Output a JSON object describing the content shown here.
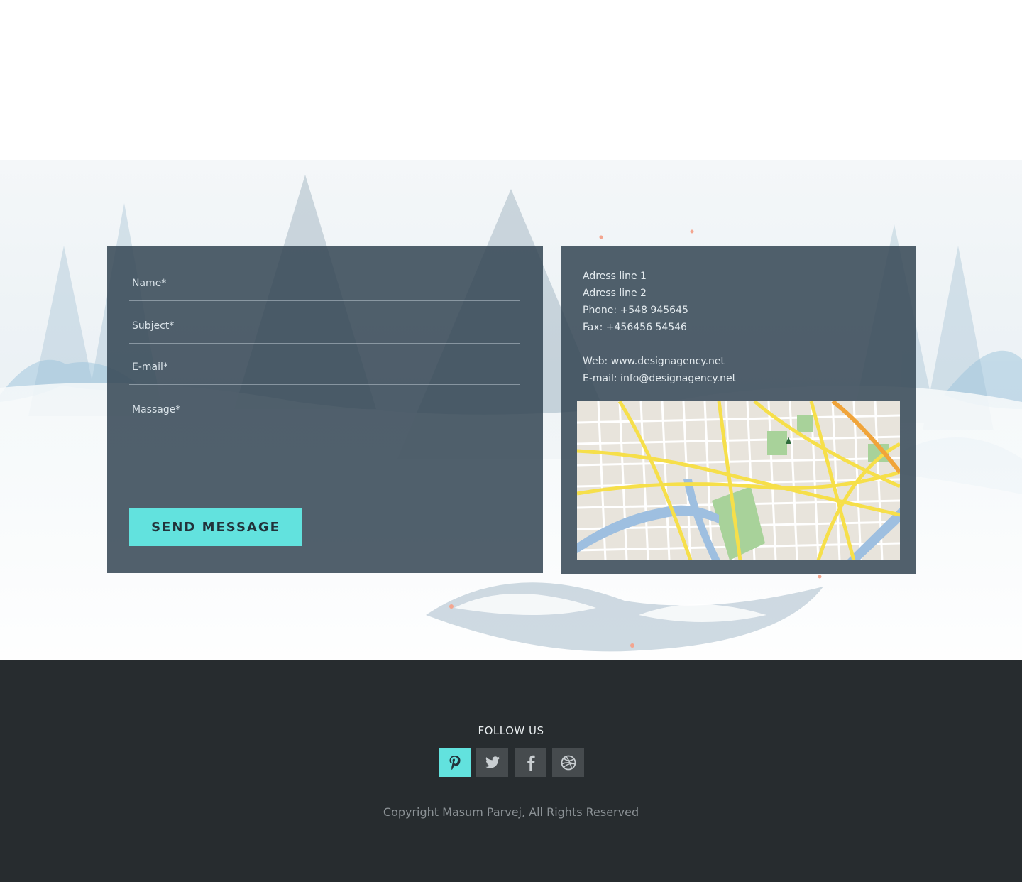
{
  "contact_form": {
    "name_placeholder": "Name*",
    "subject_placeholder": "Subject*",
    "email_placeholder": "E-mail*",
    "message_placeholder": "Massage*",
    "send_label": "SEND MESSAGE"
  },
  "contact_info": {
    "address_line_1": "Adress line 1",
    "address_line_2": "Adress line 2",
    "phone": "Phone: +548 945645",
    "fax": "Fax: +456456 54546",
    "web": "Web: www.designagency.net",
    "email": "E-mail: info@designagency.net"
  },
  "map": {
    "icon": "map-icon"
  },
  "footer": {
    "follow_label": "FOLLOW US",
    "socials": [
      {
        "icon": "pinterest-icon",
        "active": true
      },
      {
        "icon": "twitter-icon",
        "active": false
      },
      {
        "icon": "facebook-icon",
        "active": false
      },
      {
        "icon": "dribbble-icon",
        "active": false
      }
    ],
    "copyright": "Copyright Masum Parvej, All Rights Reserved"
  },
  "colors": {
    "accent": "#62e2de",
    "panel": "#344654",
    "footer_bg": "#272c2f",
    "social_bg": "#464b4e"
  }
}
